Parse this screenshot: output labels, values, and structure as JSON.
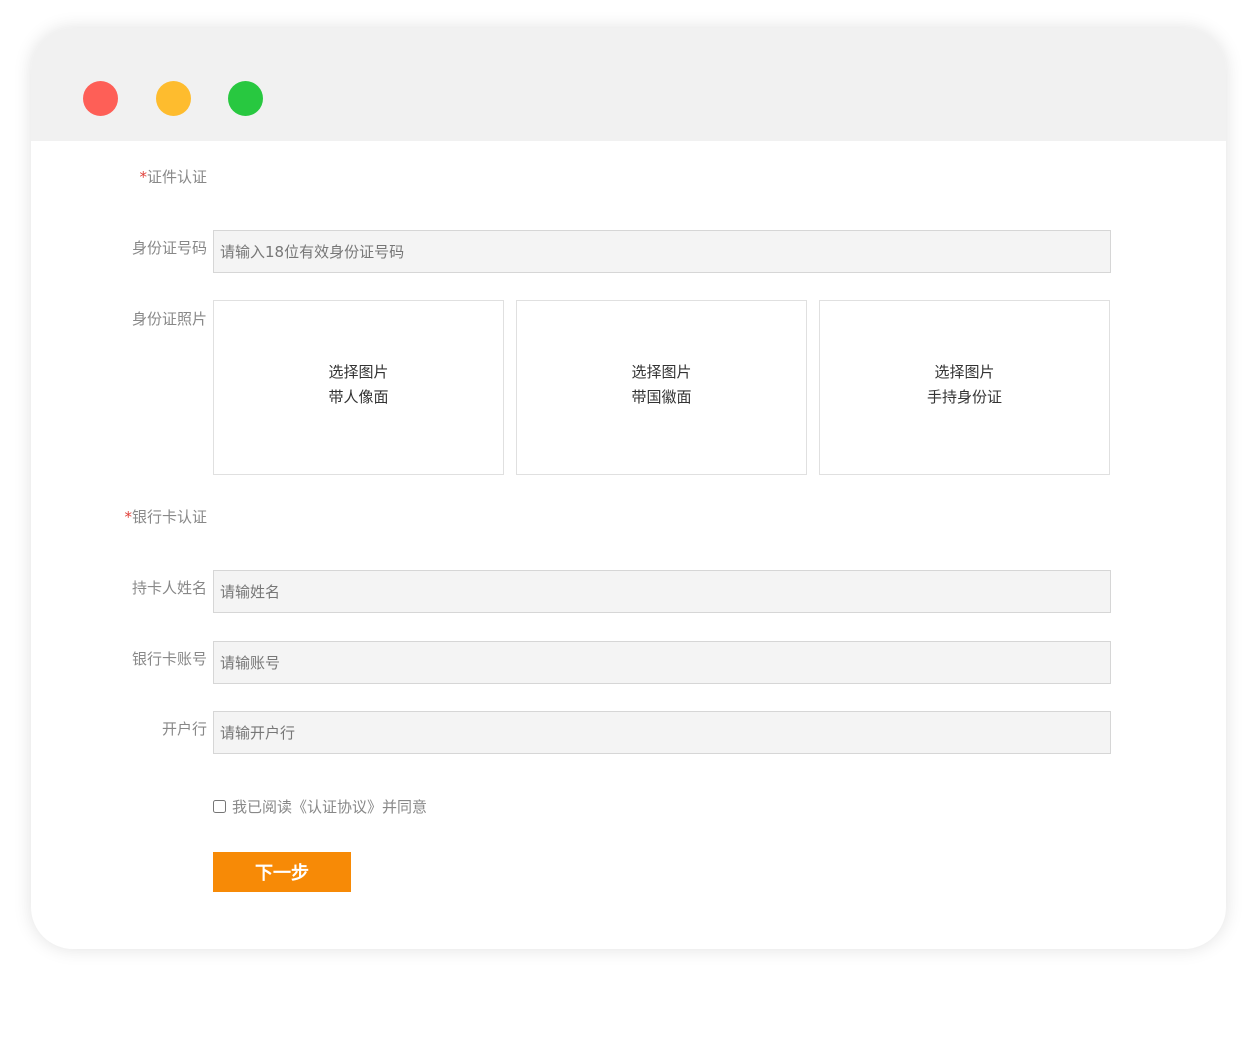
{
  "colors": {
    "dot_red": "#fe5f57",
    "dot_yellow": "#febc2e",
    "dot_green": "#28c840",
    "accent": "#f78a06",
    "required": "#e0403a"
  },
  "id_section": {
    "required_mark": "*",
    "title": "证件认证",
    "id_number": {
      "label": "身份证号码",
      "placeholder": "请输入18位有效身份证号码"
    },
    "photo": {
      "label": "身份证照片",
      "uploads": [
        {
          "action": "选择图片",
          "caption": "带人像面"
        },
        {
          "action": "选择图片",
          "caption": "带国徽面"
        },
        {
          "action": "选择图片",
          "caption": "手持身份证"
        }
      ]
    }
  },
  "bank_section": {
    "required_mark": "*",
    "title": "银行卡认证",
    "holder": {
      "label": "持卡人姓名",
      "placeholder": "请输姓名"
    },
    "account": {
      "label": "银行卡账号",
      "placeholder": "请输账号"
    },
    "bank": {
      "label": "开户行",
      "placeholder": "请输开户行"
    }
  },
  "agreement": {
    "text": "我已阅读《认证协议》并同意",
    "checked": false
  },
  "next_button": {
    "label": "下一步"
  }
}
